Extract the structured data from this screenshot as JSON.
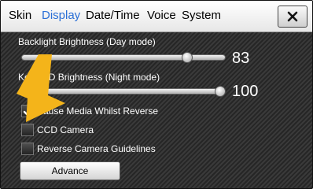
{
  "tabs": [
    "Skin",
    "Display",
    "Date/Time",
    "Voice",
    "System"
  ],
  "active_tab": "Display",
  "day_brightness": {
    "label": "Backlight Brightness (Day mode)",
    "value": "83",
    "level": 0.83
  },
  "night_brightness": {
    "label": "Key LED Brightness (Night mode)",
    "value": "100",
    "level": 1.0
  },
  "checkboxes": [
    {
      "label": "Pause Media Whilst Reverse",
      "checked": true
    },
    {
      "label": "CCD Camera",
      "checked": false
    },
    {
      "label": "Reverse Camera Guidelines",
      "checked": false
    }
  ],
  "advance_label": "Advance",
  "colors": {
    "active_tab": "#2a6fd6",
    "pointer": "#f4b41a"
  },
  "icons": {
    "close": "close-icon",
    "check": "check-icon",
    "pointer": "arrow-pointer-icon"
  }
}
